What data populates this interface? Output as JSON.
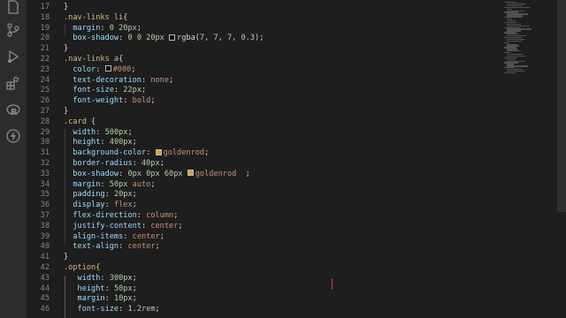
{
  "activity_bar": {
    "icons": [
      "explorer-icon",
      "search-icon",
      "source-control-icon",
      "run-debug-icon",
      "extensions-icon",
      "r-icon",
      "bolt-icon"
    ]
  },
  "editor": {
    "lines": [
      {
        "n": "17",
        "t": [
          {
            "c": "pun",
            "v": "}"
          }
        ]
      },
      {
        "n": "18",
        "t": [
          {
            "c": "sel",
            "v": ".nav-links li"
          },
          {
            "c": "pun",
            "v": "{"
          }
        ]
      },
      {
        "n": "19",
        "t": [
          {
            "c": "pun",
            "v": "  "
          },
          {
            "c": "prop",
            "v": "margin"
          },
          {
            "c": "pun",
            "v": ": "
          },
          {
            "c": "num",
            "v": "0 20px"
          },
          {
            "c": "pun",
            "v": ";"
          }
        ]
      },
      {
        "n": "20",
        "t": [
          {
            "c": "pun",
            "v": "  "
          },
          {
            "c": "prop",
            "v": "box-shadow"
          },
          {
            "c": "pun",
            "v": ": "
          },
          {
            "c": "num",
            "v": "0 0 20px "
          },
          {
            "swatch": "#070707"
          },
          {
            "c": "pun",
            "v": "rgba("
          },
          {
            "c": "num",
            "v": "7, 7, 7, 0.3"
          },
          {
            "c": "pun",
            "v": ");"
          }
        ]
      },
      {
        "n": "21",
        "t": [
          {
            "c": "pun",
            "v": "}"
          }
        ]
      },
      {
        "n": "22",
        "t": [
          {
            "c": "sel",
            "v": ".nav-links a"
          },
          {
            "c": "pun",
            "v": "{"
          }
        ]
      },
      {
        "n": "23",
        "t": [
          {
            "c": "pun",
            "v": "  "
          },
          {
            "c": "prop",
            "v": "color"
          },
          {
            "c": "pun",
            "v": ": "
          },
          {
            "swatch": "#000000"
          },
          {
            "c": "val",
            "v": "#000"
          },
          {
            "c": "pun",
            "v": ";"
          }
        ]
      },
      {
        "n": "24",
        "t": [
          {
            "c": "pun",
            "v": "  "
          },
          {
            "c": "prop",
            "v": "text-decoration"
          },
          {
            "c": "pun",
            "v": ": "
          },
          {
            "c": "val",
            "v": "none"
          },
          {
            "c": "pun",
            "v": ";"
          }
        ]
      },
      {
        "n": "25",
        "t": [
          {
            "c": "pun",
            "v": "  "
          },
          {
            "c": "prop",
            "v": "font-size"
          },
          {
            "c": "pun",
            "v": ": "
          },
          {
            "c": "num",
            "v": "22px"
          },
          {
            "c": "pun",
            "v": ";"
          }
        ]
      },
      {
        "n": "26",
        "t": [
          {
            "c": "pun",
            "v": "  "
          },
          {
            "c": "prop",
            "v": "font-weight"
          },
          {
            "c": "pun",
            "v": ": "
          },
          {
            "c": "val",
            "v": "bold"
          },
          {
            "c": "pun",
            "v": ";"
          }
        ]
      },
      {
        "n": "27",
        "t": [
          {
            "c": "pun",
            "v": "}"
          }
        ]
      },
      {
        "n": "28",
        "t": [
          {
            "c": "sel",
            "v": ".card"
          },
          {
            "c": "pun",
            "v": " {"
          }
        ]
      },
      {
        "n": "29",
        "t": [
          {
            "c": "pun",
            "v": "  "
          },
          {
            "c": "prop",
            "v": "width"
          },
          {
            "c": "pun",
            "v": ": "
          },
          {
            "c": "num",
            "v": "500px"
          },
          {
            "c": "pun",
            "v": ";"
          }
        ]
      },
      {
        "n": "30",
        "t": [
          {
            "c": "pun",
            "v": "  "
          },
          {
            "c": "prop",
            "v": "height"
          },
          {
            "c": "pun",
            "v": ": "
          },
          {
            "c": "num",
            "v": "400px"
          },
          {
            "c": "pun",
            "v": ";"
          }
        ]
      },
      {
        "n": "31",
        "t": [
          {
            "c": "pun",
            "v": "  "
          },
          {
            "c": "prop",
            "v": "background-color"
          },
          {
            "c": "pun",
            "v": ": "
          },
          {
            "swatch": "#daa520"
          },
          {
            "c": "val",
            "v": "goldenrod"
          },
          {
            "c": "pun",
            "v": ";"
          }
        ]
      },
      {
        "n": "32",
        "t": [
          {
            "c": "pun",
            "v": "  "
          },
          {
            "c": "prop",
            "v": "border-radius"
          },
          {
            "c": "pun",
            "v": ": "
          },
          {
            "c": "num",
            "v": "40px"
          },
          {
            "c": "pun",
            "v": ";"
          }
        ]
      },
      {
        "n": "33",
        "t": [
          {
            "c": "pun",
            "v": "  "
          },
          {
            "c": "prop",
            "v": "box-shadow"
          },
          {
            "c": "pun",
            "v": ": "
          },
          {
            "c": "num",
            "v": "0px 0px 60px "
          },
          {
            "swatch": "#daa520"
          },
          {
            "c": "val",
            "v": "goldenrod"
          },
          {
            "c": "pun",
            "v": "  ;"
          }
        ]
      },
      {
        "n": "34",
        "t": [
          {
            "c": "pun",
            "v": "  "
          },
          {
            "c": "prop",
            "v": "margin"
          },
          {
            "c": "pun",
            "v": ": "
          },
          {
            "c": "num",
            "v": "50px "
          },
          {
            "c": "val",
            "v": "auto"
          },
          {
            "c": "pun",
            "v": ";"
          }
        ]
      },
      {
        "n": "35",
        "t": [
          {
            "c": "pun",
            "v": "  "
          },
          {
            "c": "prop",
            "v": "padding"
          },
          {
            "c": "pun",
            "v": ": "
          },
          {
            "c": "num",
            "v": "20px"
          },
          {
            "c": "pun",
            "v": ";"
          }
        ]
      },
      {
        "n": "36",
        "t": [
          {
            "c": "pun",
            "v": "  "
          },
          {
            "c": "prop",
            "v": "display"
          },
          {
            "c": "pun",
            "v": ": "
          },
          {
            "c": "val",
            "v": "flex"
          },
          {
            "c": "pun",
            "v": ";"
          }
        ]
      },
      {
        "n": "37",
        "t": [
          {
            "c": "pun",
            "v": "  "
          },
          {
            "c": "prop",
            "v": "flex-direction"
          },
          {
            "c": "pun",
            "v": ": "
          },
          {
            "c": "val",
            "v": "column"
          },
          {
            "c": "pun",
            "v": ";"
          }
        ]
      },
      {
        "n": "38",
        "t": [
          {
            "c": "pun",
            "v": "  "
          },
          {
            "c": "prop",
            "v": "justify-content"
          },
          {
            "c": "pun",
            "v": ": "
          },
          {
            "c": "val",
            "v": "center"
          },
          {
            "c": "pun",
            "v": ";"
          }
        ]
      },
      {
        "n": "39",
        "t": [
          {
            "c": "pun",
            "v": "  "
          },
          {
            "c": "prop",
            "v": "align-items"
          },
          {
            "c": "pun",
            "v": ": "
          },
          {
            "c": "val",
            "v": "center"
          },
          {
            "c": "pun",
            "v": ";"
          }
        ]
      },
      {
        "n": "40",
        "t": [
          {
            "c": "pun",
            "v": "  "
          },
          {
            "c": "prop",
            "v": "text-align"
          },
          {
            "c": "pun",
            "v": ": "
          },
          {
            "c": "val",
            "v": "center"
          },
          {
            "c": "pun",
            "v": ";"
          }
        ]
      },
      {
        "n": "41",
        "t": [
          {
            "c": "pun",
            "v": "}"
          }
        ]
      },
      {
        "n": "42",
        "t": [
          {
            "c": "sel",
            "v": ".option"
          },
          {
            "c": "brace",
            "v": "{"
          }
        ]
      },
      {
        "n": "43",
        "t": [
          {
            "c": "pun",
            "v": "   "
          },
          {
            "c": "prop",
            "v": "width"
          },
          {
            "c": "pun",
            "v": ": "
          },
          {
            "c": "num",
            "v": "300px"
          },
          {
            "c": "pun",
            "v": ";"
          }
        ]
      },
      {
        "n": "44",
        "t": [
          {
            "c": "pun",
            "v": "   "
          },
          {
            "c": "prop",
            "v": "height"
          },
          {
            "c": "pun",
            "v": ": "
          },
          {
            "c": "num",
            "v": "50px"
          },
          {
            "c": "pun",
            "v": ";"
          }
        ]
      },
      {
        "n": "45",
        "t": [
          {
            "c": "pun",
            "v": "   "
          },
          {
            "c": "prop",
            "v": "margin"
          },
          {
            "c": "pun",
            "v": ": "
          },
          {
            "c": "num",
            "v": "10px"
          },
          {
            "c": "pun",
            "v": ";"
          }
        ]
      },
      {
        "n": "46",
        "t": [
          {
            "c": "pun",
            "v": "   "
          },
          {
            "c": "prop",
            "v": "font-size"
          },
          {
            "c": "pun",
            "v": ": "
          },
          {
            "c": "num",
            "v": "1.2rem"
          },
          {
            "c": "pun",
            "v": ";"
          }
        ]
      }
    ]
  },
  "colors": {
    "background": "#1e1e1e",
    "activity_bar": "#2c2c2c",
    "selector": "#d7ba7d",
    "property": "#9cdcfe",
    "value": "#ce9178",
    "number": "#b5cea8",
    "caret": "#e03c31"
  }
}
